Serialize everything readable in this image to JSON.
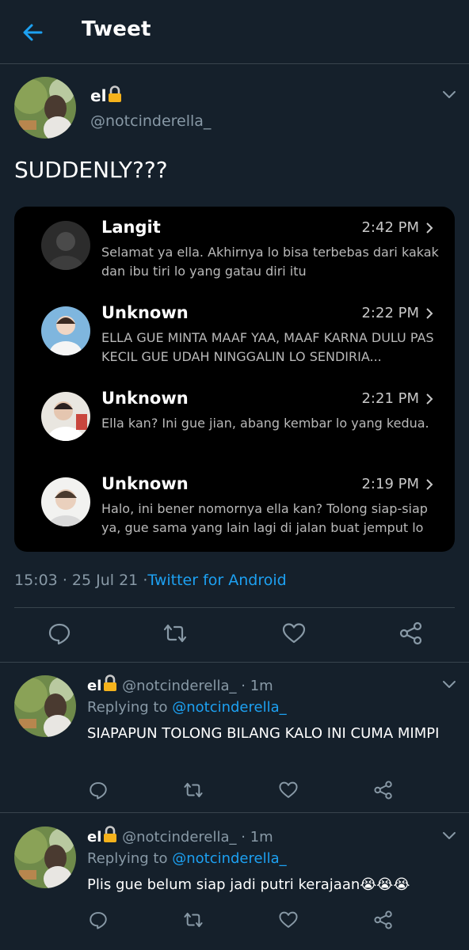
{
  "header": {
    "title": "Tweet",
    "back_icon": "arrow-left-icon",
    "accent": "#1da1f2"
  },
  "main_tweet": {
    "name": "el",
    "lock_icon": "lock-icon",
    "handle": "@notcinderella_",
    "text": "SUDDENLY???",
    "screenshot": {
      "messages": [
        {
          "name": "Langit",
          "time": "2:42 PM",
          "preview": "Selamat ya ella. Akhirnya lo bisa terbebas dari kakak dan ibu tiri lo yang gatau diri itu"
        },
        {
          "name": "Unknown",
          "time": "2:22 PM",
          "preview": "ELLA GUE MINTA MAAF YAA, MAAF KARNA DULU PAS KECIL GUE UDAH NINGGALIN LO SENDIRIA..."
        },
        {
          "name": "Unknown",
          "time": "2:21 PM",
          "preview": "Ella kan? Ini gue jian, abang kembar lo yang kedua."
        },
        {
          "name": "Unknown",
          "time": "2:19 PM",
          "preview": "Halo, ini bener nomornya ella kan? Tolong siap-siap ya, gue sama yang lain lagi di jalan buat jemput lo"
        }
      ]
    },
    "time": "15:03",
    "date": "25 Jul 21",
    "client": "Twitter for Android",
    "actions": [
      "reply-icon",
      "retweet-icon",
      "like-icon",
      "share-icon"
    ]
  },
  "replies": [
    {
      "name": "el",
      "handle": "@notcinderella_",
      "age": "1m",
      "replying_prefix": "Replying to",
      "replying_to": "@notcinderella_",
      "text": "SIAPAPUN TOLONG BILANG KALO INI CUMA MIMPI"
    },
    {
      "name": "el",
      "handle": "@notcinderella_",
      "age": "1m",
      "replying_prefix": "Replying to",
      "replying_to": "@notcinderella_",
      "text": "Plis gue belum siap jadi putri kerajaan😭😭😭"
    }
  ],
  "separator": "·"
}
